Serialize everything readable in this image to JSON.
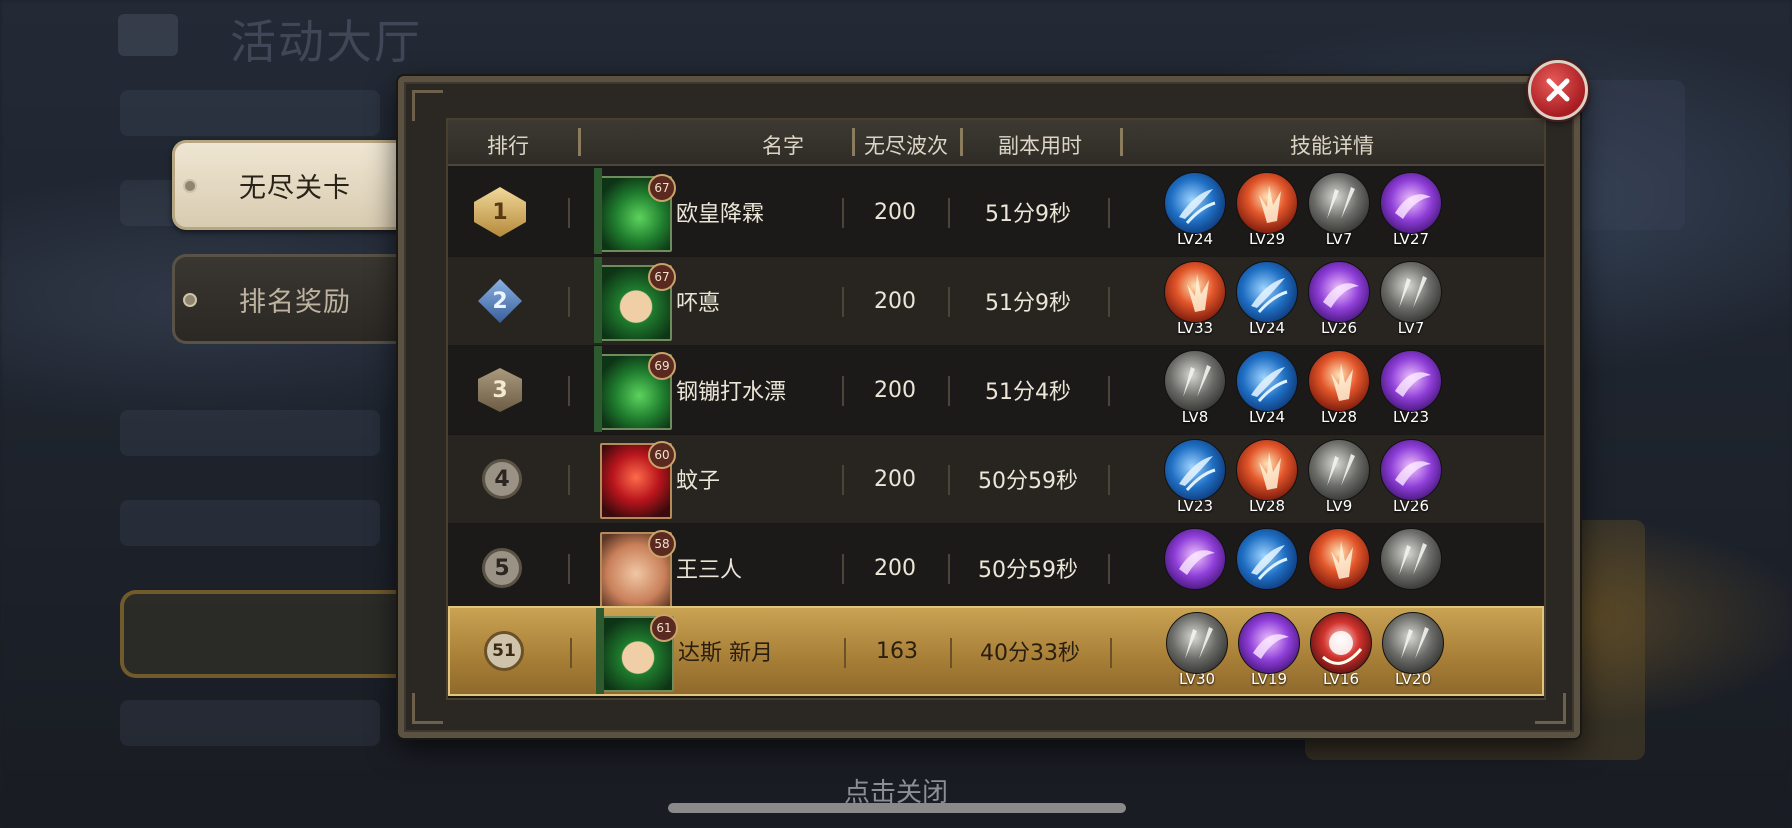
{
  "background": {
    "title": "活动大厅",
    "close_hint": "点击关闭"
  },
  "tabs": [
    {
      "label": "无尽关卡",
      "active": true
    },
    {
      "label": "排名奖励",
      "active": false
    }
  ],
  "table": {
    "headers": {
      "rank": "排行",
      "name": "名字",
      "waves": "无尽波次",
      "time": "副本用时",
      "skills": "技能详情"
    },
    "rows": [
      {
        "rank": "1",
        "badge": "gold",
        "avatar": "green",
        "avatar_level": "67",
        "name": "欧皇降霖",
        "waves": "200",
        "time": "51分9秒",
        "skills": [
          {
            "type": "blue",
            "level": "LV24"
          },
          {
            "type": "red",
            "level": "LV29"
          },
          {
            "type": "grey",
            "level": "LV7"
          },
          {
            "type": "purple",
            "level": "LV27"
          }
        ]
      },
      {
        "rank": "2",
        "badge": "blue",
        "avatar": "tan",
        "avatar_level": "67",
        "name": "吥悳",
        "waves": "200",
        "time": "51分9秒",
        "skills": [
          {
            "type": "red",
            "level": "LV33"
          },
          {
            "type": "blue",
            "level": "LV24"
          },
          {
            "type": "purple",
            "level": "LV26"
          },
          {
            "type": "grey",
            "level": "LV7"
          }
        ]
      },
      {
        "rank": "3",
        "badge": "bronze",
        "avatar": "green",
        "avatar_level": "69",
        "name": "钢镚打水漂",
        "waves": "200",
        "time": "51分4秒",
        "skills": [
          {
            "type": "grey",
            "level": "LV8"
          },
          {
            "type": "blue",
            "level": "LV24"
          },
          {
            "type": "red",
            "level": "LV28"
          },
          {
            "type": "purple",
            "level": "LV23"
          }
        ]
      },
      {
        "rank": "4",
        "badge": "circle",
        "avatar": "red",
        "avatar_level": "60",
        "name": "蚊子",
        "waves": "200",
        "time": "50分59秒",
        "skills": [
          {
            "type": "blue",
            "level": "LV23"
          },
          {
            "type": "red",
            "level": "LV28"
          },
          {
            "type": "grey",
            "level": "LV9"
          },
          {
            "type": "purple",
            "level": "LV26"
          }
        ]
      },
      {
        "rank": "5",
        "badge": "circle",
        "avatar": "egg",
        "avatar_level": "58",
        "name": "王三人",
        "waves": "200",
        "time": "50分59秒",
        "skills": [
          {
            "type": "purple",
            "level": ""
          },
          {
            "type": "blue",
            "level": ""
          },
          {
            "type": "red",
            "level": ""
          },
          {
            "type": "grey",
            "level": ""
          }
        ]
      }
    ],
    "self_row": {
      "rank": "51",
      "avatar": "tan",
      "avatar_level": "61",
      "name": "达斯 新月",
      "waves": "163",
      "time": "40分33秒",
      "skills": [
        {
          "type": "grey",
          "level": "LV30"
        },
        {
          "type": "purple",
          "level": "LV19"
        },
        {
          "type": "redb",
          "level": "LV16"
        },
        {
          "type": "grey",
          "level": "LV20"
        }
      ]
    }
  },
  "icons": {
    "close": "close-icon",
    "skill_blue": "water-slash-icon",
    "skill_red": "fire-burst-icon",
    "skill_grey": "twin-blades-icon",
    "skill_purple": "arcane-wave-icon"
  },
  "colors": {
    "accent_gold": "#c9a254",
    "close_red": "#c5262b",
    "panel_bg": "#1a1816"
  }
}
